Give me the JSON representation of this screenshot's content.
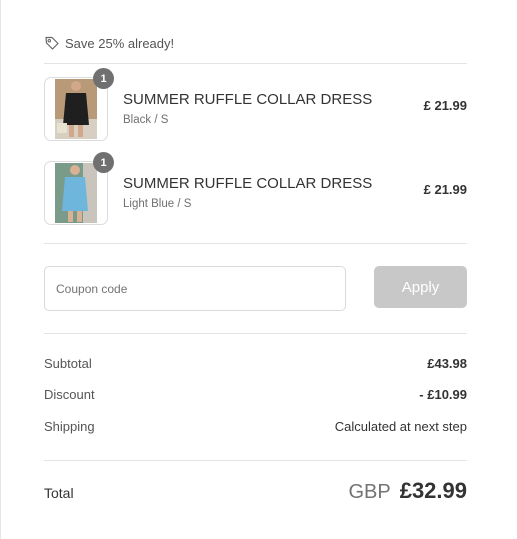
{
  "savings": {
    "icon": "tag-icon",
    "text": "Save 25% already!"
  },
  "products": [
    {
      "quantity": "1",
      "name": "SUMMER RUFFLE COLLAR DRESS",
      "variant": "Black / S",
      "price": "£ 21.99",
      "color": "#1f1f1f"
    },
    {
      "quantity": "1",
      "name": "SUMMER RUFFLE COLLAR DRESS",
      "variant": "Light Blue / S",
      "price": "£ 21.99",
      "color": "#6fb6dc"
    }
  ],
  "coupon": {
    "placeholder": "Coupon code",
    "value": "",
    "apply_label": "Apply"
  },
  "totals": {
    "subtotal_label": "Subtotal",
    "subtotal_value": "£43.98",
    "discount_label": "Discount",
    "discount_value": "- £10.99",
    "shipping_label": "Shipping",
    "shipping_value": "Calculated at next step",
    "total_label": "Total",
    "total_currency": "GBP",
    "total_value": "£32.99"
  },
  "colors": {
    "apply_button_disabled": "#c8c8c8",
    "badge": "#707070",
    "divider": "#e3e3e3"
  }
}
